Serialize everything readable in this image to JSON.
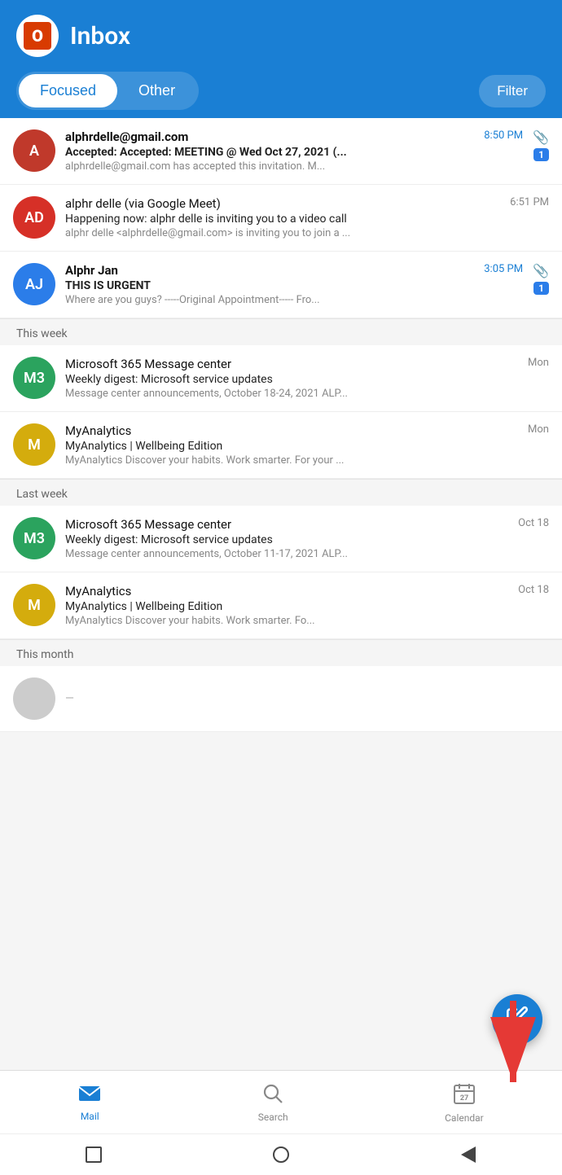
{
  "header": {
    "logo_letter": "O",
    "title": "Inbox",
    "tab_focused": "Focused",
    "tab_other": "Other",
    "filter_label": "Filter"
  },
  "emails": {
    "today": [
      {
        "id": "email-1",
        "avatar_letters": "A",
        "avatar_color": "red",
        "sender": "alphrdelle@gmail.com",
        "time": "8:50 PM",
        "time_blue": true,
        "subject": "Accepted: Accepted: MEETING @ Wed Oct 27, 2021 (...",
        "preview": "alphrdelle@gmail.com has accepted this invitation. M...",
        "has_attachment": true,
        "count": "1",
        "unread": true
      },
      {
        "id": "email-2",
        "avatar_letters": "AD",
        "avatar_color": "red-dark",
        "sender": "alphr delle (via Google Meet)",
        "time": "6:51 PM",
        "time_blue": false,
        "subject": "Happening now: alphr delle is inviting you to a video call",
        "preview": "alphr delle <alphrdelle@gmail.com> is inviting you to join a ...",
        "has_attachment": false,
        "count": null,
        "unread": false
      },
      {
        "id": "email-3",
        "avatar_letters": "AJ",
        "avatar_color": "blue",
        "sender": "Alphr Jan",
        "time": "3:05 PM",
        "time_blue": true,
        "subject": "THIS IS URGENT",
        "preview": "Where are you guys? -----Original Appointment----- Fro...",
        "has_attachment": true,
        "count": "1",
        "unread": true
      }
    ],
    "this_week_label": "This week",
    "this_week": [
      {
        "id": "email-4",
        "avatar_letters": "M3",
        "avatar_color": "green",
        "sender": "Microsoft 365 Message center",
        "time": "Mon",
        "time_blue": false,
        "subject": "Weekly digest: Microsoft service updates",
        "preview": "Message center announcements, October 18-24, 2021 ALP...",
        "has_attachment": false,
        "count": null,
        "unread": false
      },
      {
        "id": "email-5",
        "avatar_letters": "M",
        "avatar_color": "yellow",
        "sender": "MyAnalytics",
        "time": "Mon",
        "time_blue": false,
        "subject": "MyAnalytics | Wellbeing Edition",
        "preview": "MyAnalytics Discover your habits. Work smarter. For your ...",
        "has_attachment": false,
        "count": null,
        "unread": false
      }
    ],
    "last_week_label": "Last week",
    "last_week": [
      {
        "id": "email-6",
        "avatar_letters": "M3",
        "avatar_color": "green",
        "sender": "Microsoft 365 Message center",
        "time": "Oct 18",
        "time_blue": false,
        "subject": "Weekly digest: Microsoft service updates",
        "preview": "Message center announcements, October 11-17, 2021 ALP...",
        "has_attachment": false,
        "count": null,
        "unread": false
      },
      {
        "id": "email-7",
        "avatar_letters": "M",
        "avatar_color": "yellow",
        "sender": "MyAnalytics",
        "time": "Oct 18",
        "time_blue": false,
        "subject": "MyAnalytics | Wellbeing Edition",
        "preview": "MyAnalytics Discover your habits. Work smarter. Fo...",
        "has_attachment": false,
        "count": null,
        "unread": false
      }
    ],
    "this_month_label": "This month"
  },
  "nav": {
    "mail_label": "Mail",
    "search_label": "Search",
    "calendar_label": "Calendar"
  },
  "fab": {
    "icon": "✏"
  }
}
